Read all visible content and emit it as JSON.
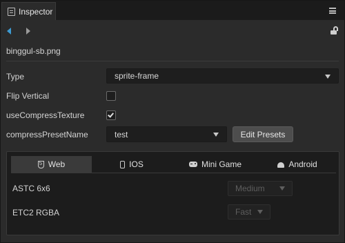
{
  "tab": {
    "title": "Inspector",
    "icon": "inspector-panel-icon"
  },
  "header": {
    "menu_icon": "hamburger-menu-icon",
    "back_icon": "arrow-left-icon",
    "forward_icon": "arrow-right-icon",
    "lock_icon": "unlock-icon"
  },
  "asset": {
    "filename": "binggul-sb.png"
  },
  "props": {
    "type": {
      "label": "Type",
      "value": "sprite-frame"
    },
    "flip_vertical": {
      "label": "Flip Vertical",
      "checked": false
    },
    "use_compress": {
      "label": "useCompressTexture",
      "checked": true
    },
    "preset": {
      "label": "compressPresetName",
      "value": "test",
      "button": "Edit Presets"
    }
  },
  "platforms": {
    "tabs": [
      {
        "label": "Web",
        "icon": "html5-icon",
        "active": true
      },
      {
        "label": "IOS",
        "icon": "phone-icon",
        "active": false
      },
      {
        "label": "Mini Game",
        "icon": "gamepad-icon",
        "active": false
      },
      {
        "label": "Android",
        "icon": "android-icon",
        "active": false
      }
    ],
    "rows": [
      {
        "label": "ASTC 6x6",
        "value": "Medium"
      },
      {
        "label": "ETC2 RGBA",
        "value": "Fast"
      }
    ]
  },
  "colors": {
    "accent": "#3d9bd3",
    "background": "#2b2b2b",
    "tabbar": "#1b1b1b"
  }
}
